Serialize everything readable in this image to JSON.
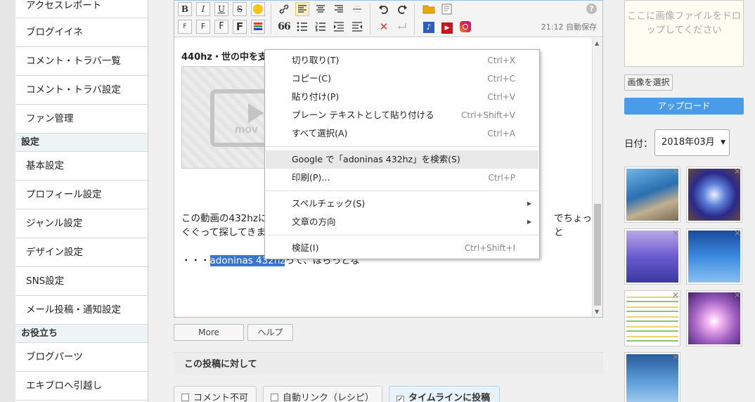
{
  "sidebar": {
    "items": [
      {
        "label": "アクセスレポート"
      },
      {
        "label": "ブログイイネ"
      },
      {
        "label": "コメント・トラバ一覧"
      },
      {
        "label": "コメント・トラバ設定"
      },
      {
        "label": "ファン管理"
      }
    ],
    "section_settings": "設定",
    "settings_items": [
      {
        "label": "基本設定"
      },
      {
        "label": "プロフィール設定"
      },
      {
        "label": "ジャンル設定"
      },
      {
        "label": "デザイン設定"
      },
      {
        "label": "SNS設定"
      },
      {
        "label": "メール投稿・通知設定"
      }
    ],
    "section_useful": "お役立ち",
    "useful_items": [
      {
        "label": "ブログパーツ"
      },
      {
        "label": "エキブロへ引越し"
      }
    ]
  },
  "toolbar": {
    "bold": "B",
    "italic": "I",
    "underline": "U",
    "strike": "S",
    "font_small": "F",
    "font_medium": "F",
    "font_large": "F",
    "font_xlarge": "F",
    "quote": "66",
    "autosave": "21:12 自動保存",
    "help": "?"
  },
  "editor": {
    "title": "440hz・世の中を支",
    "video_placeholder": "mov",
    "para1_left": "この動画の432hzに",
    "para1_right": "でちょっと",
    "para1_line2": "ぐぐって探してきま",
    "para2_prefix": "・・・",
    "para2_selected": "adoninas 432hz",
    "para2_suffix": "って、ほらっとな"
  },
  "context_menu": {
    "items": [
      {
        "label": "切り取り(T)",
        "shortcut": "Ctrl+X"
      },
      {
        "label": "コピー(C)",
        "shortcut": "Ctrl+C"
      },
      {
        "label": "貼り付け(P)",
        "shortcut": "Ctrl+V"
      },
      {
        "label": "プレーン テキストとして貼り付ける",
        "shortcut": "Ctrl+Shift+V"
      },
      {
        "label": "すべて選択(A)",
        "shortcut": "Ctrl+A"
      },
      {
        "label": "Google で「adoninas 432hz」を検索(S)",
        "shortcut": ""
      },
      {
        "label": "印刷(P)…",
        "shortcut": "Ctrl+P"
      },
      {
        "label": "スペルチェック(S)",
        "shortcut": ""
      },
      {
        "label": "文章の方向",
        "shortcut": ""
      },
      {
        "label": "検証(I)",
        "shortcut": "Ctrl+Shift+I"
      }
    ]
  },
  "below_editor": {
    "more": "More",
    "help": "ヘルプ",
    "options_header": "この投稿に対して",
    "opt_no_comment": "コメント不可",
    "opt_auto_link": "自動リンク（レシピ）",
    "opt_timeline": "タイムラインに投稿"
  },
  "right_panel": {
    "dropzone": "ここに画像ファイルをドロップしてください",
    "select_image": "画像を選択",
    "upload": "アップロード",
    "date_label": "日付：",
    "date_value": "2018年03月"
  },
  "colors": {
    "accent_blue": "#4a9be8",
    "selection": "#3875d7",
    "editor_border": "#9ac3e6"
  }
}
